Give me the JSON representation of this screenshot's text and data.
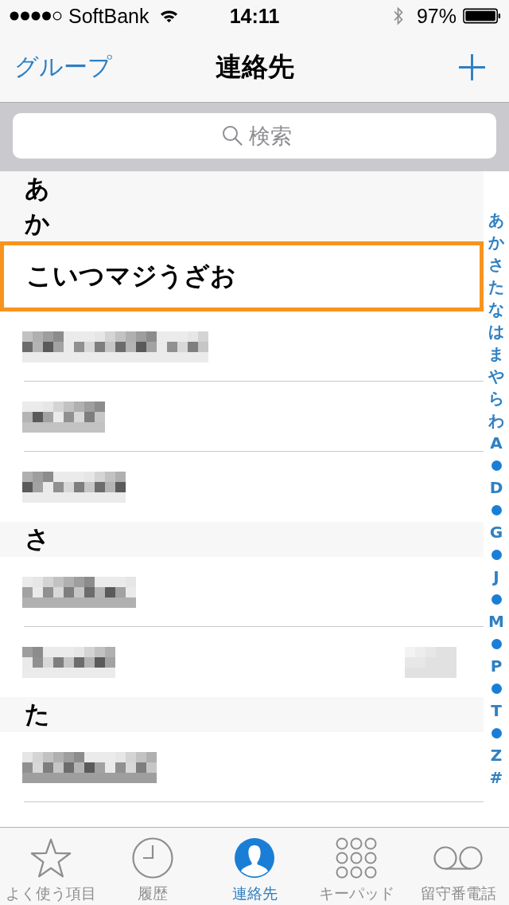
{
  "status_bar": {
    "carrier": "SoftBank",
    "time": "14:11",
    "battery": "97%"
  },
  "nav_bar": {
    "left_button": "グループ",
    "title": "連絡先"
  },
  "search": {
    "placeholder": "検索"
  },
  "sections": [
    {
      "header": "あ"
    },
    {
      "header": "か",
      "contacts": [
        {
          "kind": "name",
          "name": "こいつマジうざお",
          "highlighted": true,
          "detail_pixelated": false
        },
        {
          "kind": "pixelated",
          "highlighted": false,
          "detail_pixelated": false
        },
        {
          "kind": "pixelated",
          "highlighted": false,
          "detail_pixelated": false
        },
        {
          "kind": "pixelated",
          "highlighted": false,
          "detail_pixelated": false
        }
      ]
    },
    {
      "header": "さ",
      "contacts": [
        {
          "kind": "pixelated",
          "highlighted": false,
          "detail_pixelated": false
        },
        {
          "kind": "pixelated",
          "highlighted": false,
          "detail_pixelated": true
        }
      ]
    },
    {
      "header": "た",
      "contacts": [
        {
          "kind": "pixelated",
          "highlighted": false,
          "detail_pixelated": false
        }
      ]
    }
  ],
  "index": [
    {
      "kind": "letter",
      "label": "あ"
    },
    {
      "kind": "letter",
      "label": "か"
    },
    {
      "kind": "letter",
      "label": "さ"
    },
    {
      "kind": "letter",
      "label": "た"
    },
    {
      "kind": "letter",
      "label": "な"
    },
    {
      "kind": "letter",
      "label": "は"
    },
    {
      "kind": "letter",
      "label": "ま"
    },
    {
      "kind": "letter",
      "label": "や"
    },
    {
      "kind": "letter",
      "label": "ら"
    },
    {
      "kind": "letter",
      "label": "わ"
    },
    {
      "kind": "letter",
      "label": "A"
    },
    {
      "kind": "dot"
    },
    {
      "kind": "letter",
      "label": "D"
    },
    {
      "kind": "dot"
    },
    {
      "kind": "letter",
      "label": "G"
    },
    {
      "kind": "dot"
    },
    {
      "kind": "letter",
      "label": "J"
    },
    {
      "kind": "dot"
    },
    {
      "kind": "letter",
      "label": "M"
    },
    {
      "kind": "dot"
    },
    {
      "kind": "letter",
      "label": "P"
    },
    {
      "kind": "dot"
    },
    {
      "kind": "letter",
      "label": "T"
    },
    {
      "kind": "dot"
    },
    {
      "kind": "letter",
      "label": "Z"
    },
    {
      "kind": "letter",
      "label": "#"
    }
  ],
  "tab_bar": [
    {
      "label": "よく使う項目",
      "selected": false
    },
    {
      "label": "履歴",
      "selected": false
    },
    {
      "label": "連絡先",
      "selected": true
    },
    {
      "label": "キーパッド",
      "selected": false
    },
    {
      "label": "留守番電話",
      "selected": false
    }
  ]
}
